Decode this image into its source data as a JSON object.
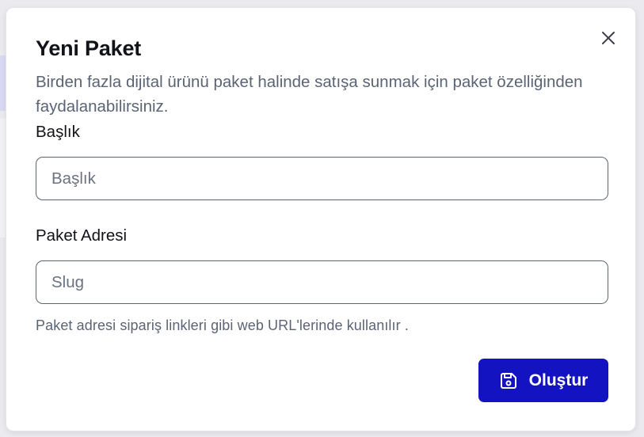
{
  "modal": {
    "title": "Yeni Paket",
    "description": "Birden fazla dijital ürünü paket halinde satışa sunmak için paket özelliğinden faydalanabilirsiniz.",
    "close_icon": "close-icon"
  },
  "form": {
    "title_field": {
      "label": "Başlık",
      "placeholder": "Başlık",
      "value": ""
    },
    "slug_field": {
      "label": "Paket Adresi",
      "placeholder": "Slug",
      "value": "",
      "hint": "Paket adresi sipariş linkleri gibi web URL'lerinde kullanılır ."
    },
    "submit": {
      "label": "Oluştur",
      "icon": "save-icon"
    }
  },
  "colors": {
    "primary": "#1313c2",
    "text": "#111318",
    "muted": "#5b6474",
    "border": "#5e6472"
  }
}
